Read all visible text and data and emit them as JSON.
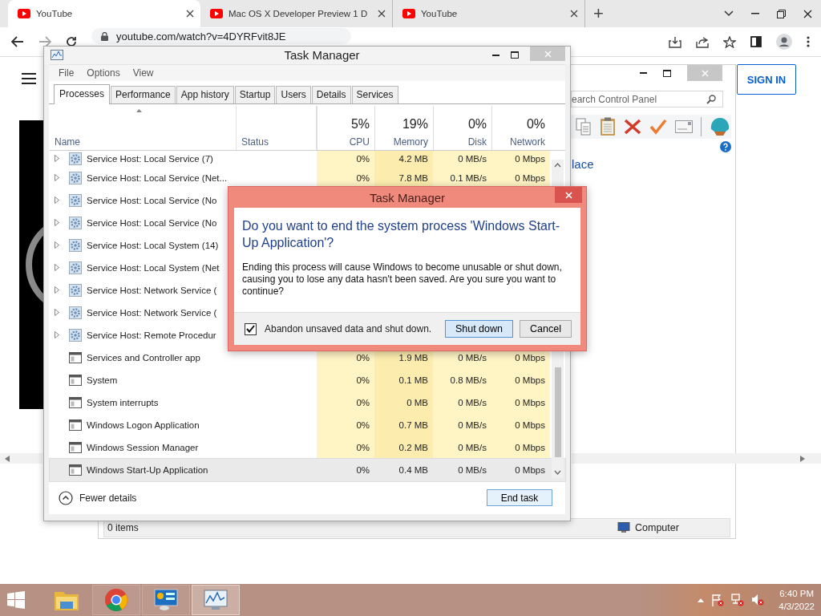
{
  "browser": {
    "tabs": [
      {
        "title": "YouTube",
        "selected": true
      },
      {
        "title": "Mac OS X Developer Preview 1 D",
        "selected": false
      },
      {
        "title": "YouTube",
        "selected": false
      }
    ],
    "new_tab": "+",
    "url": "youtube.com/watch?v=4DYRFvit8JE"
  },
  "youtube": {
    "sign_in": "SIGN IN"
  },
  "control_panel": {
    "search_placeholder": "earch Control Panel",
    "link": "lace",
    "status_items": "0 items",
    "status_location": "Computer"
  },
  "task_manager": {
    "title": "Task Manager",
    "menu": [
      "File",
      "Options",
      "View"
    ],
    "tabs": [
      {
        "label": "Processes",
        "selected": true
      },
      {
        "label": "Performance",
        "selected": false
      },
      {
        "label": "App history",
        "selected": false
      },
      {
        "label": "Startup",
        "selected": false
      },
      {
        "label": "Users",
        "selected": false
      },
      {
        "label": "Details",
        "selected": false
      },
      {
        "label": "Services",
        "selected": false
      }
    ],
    "columns": [
      {
        "label": "Name"
      },
      {
        "label": "Status"
      },
      {
        "percent": "5%",
        "label": "CPU"
      },
      {
        "percent": "19%",
        "label": "Memory"
      },
      {
        "percent": "0%",
        "label": "Disk"
      },
      {
        "percent": "0%",
        "label": "Network"
      }
    ],
    "rows": [
      {
        "kind": "service",
        "name": "Service Host: Local Service (7)",
        "cpu": "0%",
        "memory": "4.2 MB",
        "disk": "0 MB/s",
        "network": "0 Mbps",
        "selected": false
      },
      {
        "kind": "service",
        "name": "Service Host: Local Service (Net...",
        "cpu": "0%",
        "memory": "7.8 MB",
        "disk": "0.1 MB/s",
        "network": "0 Mbps",
        "selected": false
      },
      {
        "kind": "service",
        "name": "Service Host: Local Service (No",
        "selected": false
      },
      {
        "kind": "service",
        "name": "Service Host: Local Service (No",
        "selected": false
      },
      {
        "kind": "service",
        "name": "Service Host: Local System (14)",
        "selected": false
      },
      {
        "kind": "service",
        "name": "Service Host: Local System (Net",
        "selected": false
      },
      {
        "kind": "service",
        "name": "Service Host: Network Service (",
        "selected": false
      },
      {
        "kind": "service",
        "name": "Service Host: Network Service (",
        "selected": false
      },
      {
        "kind": "service",
        "name": "Service Host: Remote Procedur",
        "selected": false
      },
      {
        "kind": "app",
        "name": "Services and Controller app",
        "cpu": "0%",
        "memory": "1.9 MB",
        "disk": "0 MB/s",
        "network": "0 Mbps",
        "selected": false
      },
      {
        "kind": "app",
        "name": "System",
        "cpu": "0%",
        "memory": "0.1 MB",
        "disk": "0.8 MB/s",
        "network": "0 Mbps",
        "selected": false
      },
      {
        "kind": "app",
        "name": "System interrupts",
        "cpu": "0%",
        "memory": "0 MB",
        "disk": "0 MB/s",
        "network": "0 Mbps",
        "selected": false
      },
      {
        "kind": "app",
        "name": "Windows Logon Application",
        "cpu": "0%",
        "memory": "0.7 MB",
        "disk": "0 MB/s",
        "network": "0 Mbps",
        "selected": false
      },
      {
        "kind": "app",
        "name": "Windows Session Manager",
        "cpu": "0%",
        "memory": "0.2 MB",
        "disk": "0 MB/s",
        "network": "0 Mbps",
        "selected": false
      },
      {
        "kind": "app",
        "name": "Windows Start-Up Application",
        "cpu": "0%",
        "memory": "0.4 MB",
        "disk": "0 MB/s",
        "network": "0 Mbps",
        "selected": true
      }
    ],
    "fewer_details": "Fewer details",
    "end_task": "End task"
  },
  "dialog": {
    "title": "Task Manager",
    "heading": "Do you want to end the system process 'Windows Start-Up Application'?",
    "message": "Ending this process will cause Windows to become unusable or shut down, causing you to lose any data hasn't been saved. Are you sure you want to continue?",
    "checkbox": {
      "label": "Abandon unsaved data and shut down.",
      "checked": true
    },
    "buttons": [
      {
        "label": "Shut down",
        "default": true
      },
      {
        "label": "Cancel",
        "default": false
      }
    ]
  },
  "taskbar": {
    "apps": [
      {
        "kind": "explorer",
        "running": false,
        "selected": false
      },
      {
        "kind": "chrome",
        "running": true,
        "selected": false
      },
      {
        "kind": "control-panel",
        "running": true,
        "selected": false
      },
      {
        "kind": "task-manager",
        "running": true,
        "selected": true
      }
    ],
    "time": "6:40 PM",
    "date": "4/3/2022"
  }
}
